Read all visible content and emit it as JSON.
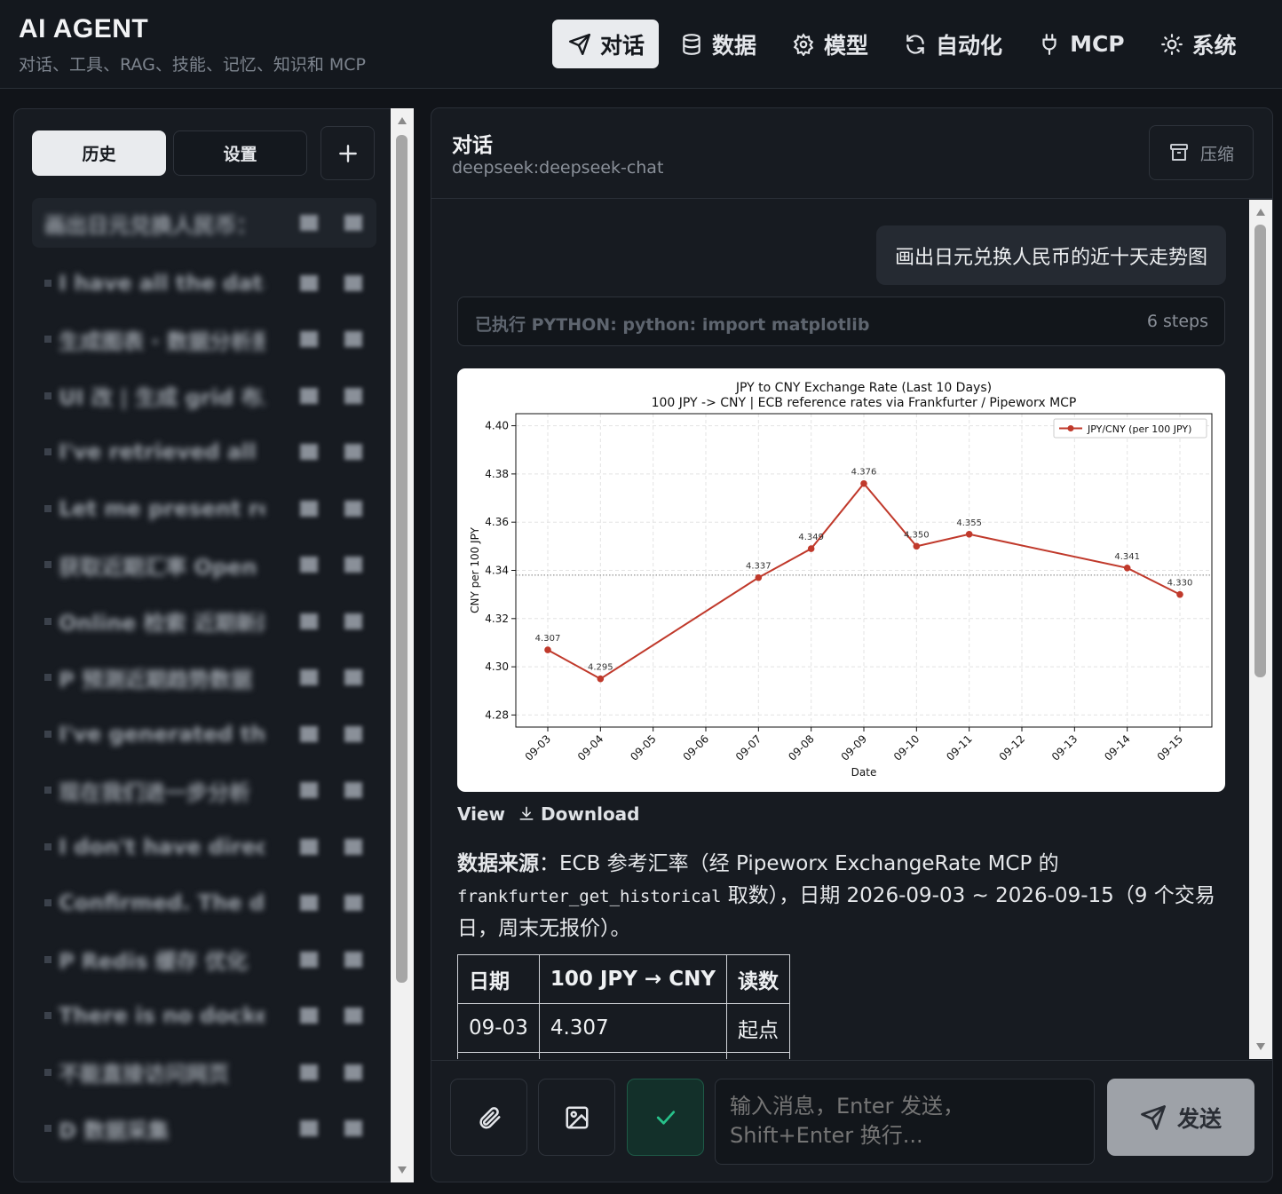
{
  "app": {
    "title": "AI AGENT",
    "subtitle": "对话、工具、RAG、技能、记忆、知识和 MCP"
  },
  "nav": [
    {
      "label": "对话",
      "icon": "send-icon",
      "active": true
    },
    {
      "label": "数据",
      "icon": "database-icon",
      "active": false
    },
    {
      "label": "模型",
      "icon": "gear-icon",
      "active": false
    },
    {
      "label": "自动化",
      "icon": "refresh-icon",
      "active": false
    },
    {
      "label": "MCP",
      "icon": "plug-icon",
      "active": false
    },
    {
      "label": "系统",
      "icon": "sun-icon",
      "active": false
    }
  ],
  "sidebar": {
    "tabs": [
      {
        "label": "历史",
        "active": true
      },
      {
        "label": "设置",
        "active": false
      }
    ],
    "new_icon": "plus-icon",
    "history": [
      "画出日元兑换人民币：DD 折线图",
      "I have all the data needed",
      "生成图表 · 数据分析报告",
      "UI 改 | 生成 grid 布局",
      "I've retrieved all data",
      "Let me present results",
      "获取近期汇率 Open data",
      "Online 检索 近期新闻",
      "P 预测近期趋势数据",
      "I've generated the chart",
      "现在我们进一步分析",
      "I don't have direct data",
      "Confirmed. The data",
      "P Redis 缓存 优化",
      "There is no docker",
      "不能直接访问网页",
      "D 数据采集"
    ]
  },
  "chat": {
    "title": "对话",
    "model": "deepseek:deepseek-chat",
    "compress_label": "压缩",
    "user_message": "画出日元兑换人民币的近十天走势图",
    "steps_label": "已执行 PYTHON: python: import matplotlib",
    "steps_count": "6 steps",
    "view_label": "View",
    "download_label": "Download",
    "para_bold": "数据来源",
    "para_text1": "：ECB 参考汇率（经 Pipeworx ExchangeRate MCP 的 ",
    "para_code": "frankfurter_get_historical",
    "para_text2": " 取数），日期 2026-09-03 ~ 2026-09-15（9 个交易日，周末无报价）。",
    "table": {
      "headers": [
        "日期",
        "100 JPY → CNY",
        "读数"
      ],
      "rows": [
        [
          "09-03",
          "4.307",
          "起点"
        ]
      ]
    },
    "composer_placeholder": "输入消息，Enter 发送，Shift+Enter 换行...",
    "send_label": "发送"
  },
  "chart_data": {
    "type": "line",
    "title": "JPY to CNY Exchange Rate (Last 10 Days)",
    "subtitle": "100 JPY -> CNY  |  ECB reference rates via Frankfurter / Pipeworx MCP",
    "xlabel": "Date",
    "ylabel": "CNY per 100 JPY",
    "x_ticks": [
      "09-03",
      "09-04",
      "09-05",
      "09-06",
      "09-07",
      "09-08",
      "09-09",
      "09-10",
      "09-11",
      "09-12",
      "09-13",
      "09-14",
      "09-15"
    ],
    "y_ticks": [
      "4.28",
      "4.30",
      "4.32",
      "4.34",
      "4.36",
      "4.38",
      "4.40"
    ],
    "ylim": [
      4.275,
      4.405
    ],
    "series": [
      {
        "name": "JPY/CNY (per 100 JPY)",
        "color": "#c0392b",
        "x": [
          "09-03",
          "09-04",
          "09-07",
          "09-08",
          "09-09",
          "09-10",
          "09-11",
          "09-14",
          "09-15"
        ],
        "values": [
          4.307,
          4.295,
          4.337,
          4.349,
          4.376,
          4.35,
          4.355,
          4.341,
          4.33
        ],
        "labels": [
          "4.307",
          "4.295",
          "4.337",
          "4.349",
          "4.376",
          "4.350",
          "4.355",
          "4.341",
          "4.330"
        ]
      }
    ],
    "mean": 4.338,
    "grid": true,
    "legend": "top-right"
  }
}
